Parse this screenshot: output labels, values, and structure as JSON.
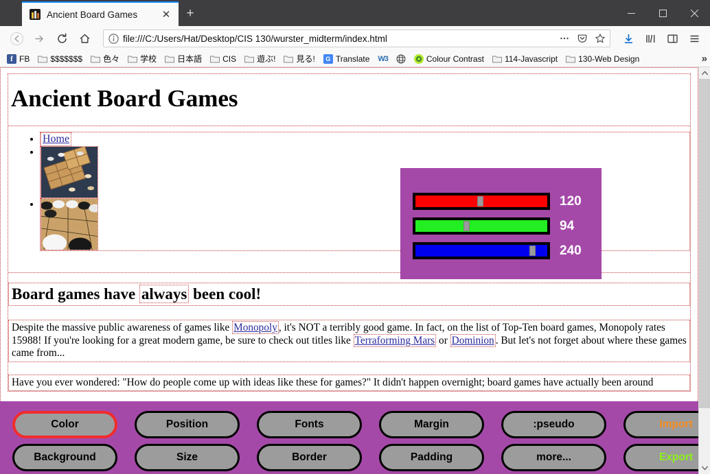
{
  "browser": {
    "tab": {
      "title": "Ancient Board Games",
      "favicon": "book-favicon",
      "close": "✕"
    },
    "newtab_label": "+",
    "window_controls": {
      "minimize": "minimize-icon",
      "maximize": "maximize-icon",
      "close": "close-icon"
    },
    "nav": {
      "back": "←",
      "forward": "→",
      "reload": "↻",
      "home": "⌂"
    },
    "url": {
      "value": "file:///C:/Users/Hat/Desktop/CIS 130/wurster_midterm/index.html",
      "info_icon": "info-icon",
      "page_actions_icon": "ellipsis-icon",
      "pocket_icon": "pocket-icon",
      "bookmark_icon": "star-icon"
    },
    "toolbar_right": {
      "downloads": "download-icon",
      "library": "library-icon",
      "sidebars": "sidebar-icon",
      "menu": "hamburger-menu-icon"
    },
    "bookmarks": [
      {
        "label": "FB",
        "icon": "facebook-icon"
      },
      {
        "label": "$$$$$$$",
        "icon": "folder-icon"
      },
      {
        "label": "色々",
        "icon": "folder-icon"
      },
      {
        "label": "学校",
        "icon": "folder-icon"
      },
      {
        "label": "日本語",
        "icon": "folder-icon"
      },
      {
        "label": "CIS",
        "icon": "folder-icon"
      },
      {
        "label": "遊ぶ!",
        "icon": "folder-icon"
      },
      {
        "label": "見る!",
        "icon": "folder-icon"
      },
      {
        "label": "Translate",
        "icon": "google-translate-icon"
      },
      {
        "label": "W3",
        "icon": "w3-icon"
      },
      {
        "label": "",
        "icon": "globe-icon"
      },
      {
        "label": "Colour Contrast",
        "icon": "colour-contrast-icon"
      },
      {
        "label": "114-Javascript",
        "icon": "folder-icon"
      },
      {
        "label": "130-Web Design",
        "icon": "folder-icon"
      }
    ],
    "bookmarks_overflow": "»"
  },
  "page": {
    "title": "Ancient Board Games",
    "nav_list": [
      {
        "label": "Home",
        "type": "link"
      },
      {
        "label": "",
        "type": "image",
        "alt": "shogi-board-thumbnail"
      },
      {
        "label": "",
        "type": "image",
        "alt": "go-board-thumbnail"
      }
    ],
    "subheading_parts": {
      "before": "Board games have ",
      "emph": "always",
      "after": " been cool!"
    },
    "paragraph1": {
      "t1": "Despite the massive public awareness of games like ",
      "l1": "Monopoly",
      "t2": ", it's NOT a terribly good game. In fact, on the list of Top-Ten board games, Monopoly rates 15988! If you're looking for a great modern game, be sure to check out titles like ",
      "l2": "Terraforming Mars",
      "t3": " or ",
      "l3": "Dominion",
      "t4": ". But let's not forget about where these games came from..."
    },
    "paragraph2": "Have you ever wondered: \"How do people come up with ideas like these for games?\" It didn't happen overnight; board games have actually been around"
  },
  "rgb_widget": {
    "background": "#a549a9",
    "sliders": [
      {
        "name": "red",
        "color": "#ff0000",
        "value": 120,
        "max": 255,
        "label": "120"
      },
      {
        "name": "green",
        "color": "#22ee22",
        "value": 94,
        "max": 255,
        "label": "94"
      },
      {
        "name": "blue",
        "color": "#0000ee",
        "value": 240,
        "max": 255,
        "label": "240"
      }
    ]
  },
  "panel": {
    "background": "#a549a9",
    "selected": "Color",
    "selected_outline": "#f22c2c",
    "columns": [
      {
        "top": "Color",
        "bottom": "Background"
      },
      {
        "top": "Position",
        "bottom": "Size"
      },
      {
        "top": "Fonts",
        "bottom": "Border"
      },
      {
        "top": "Margin",
        "bottom": "Padding"
      },
      {
        "top": ":pseudo",
        "bottom": "more..."
      }
    ],
    "import_label": "Import",
    "import_color": "#f98c1d",
    "export_label": "Export",
    "export_color": "#8cf01c"
  },
  "scrollbar": {
    "up": "▲",
    "down": "▼"
  }
}
